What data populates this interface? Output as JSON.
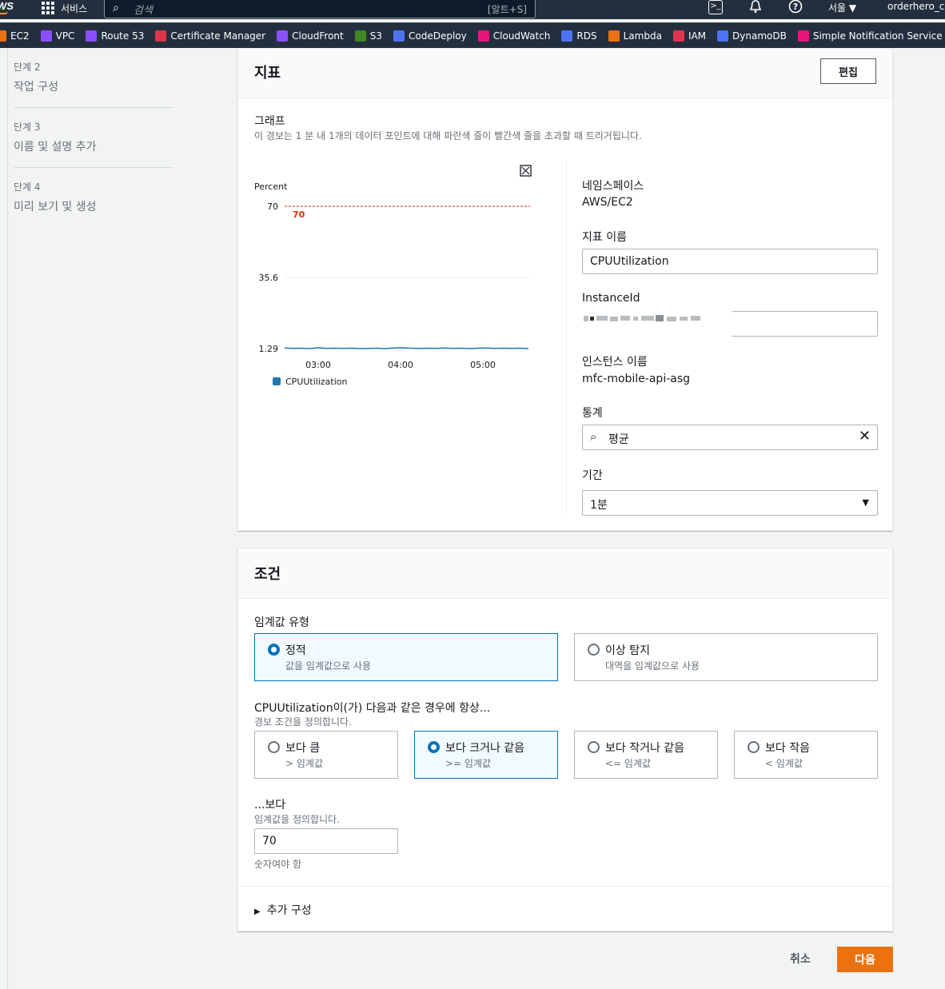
{
  "topnav": {
    "logo": "WS",
    "services_label": "서비스",
    "search_placeholder": "검색",
    "search_shortcut": "[알트+S]",
    "region": "서울 ▼",
    "account": "orderhero_ch"
  },
  "favorites": [
    {
      "label": "EC2",
      "color": "#ec7211"
    },
    {
      "label": "VPC",
      "color": "#8c4fff"
    },
    {
      "label": "Route 53",
      "color": "#8c4fff"
    },
    {
      "label": "Certificate Manager",
      "color": "#dd344c"
    },
    {
      "label": "CloudFront",
      "color": "#8c4fff"
    },
    {
      "label": "S3",
      "color": "#3f8624"
    },
    {
      "label": "CodeDeploy",
      "color": "#4d72f3"
    },
    {
      "label": "CloudWatch",
      "color": "#e7157b"
    },
    {
      "label": "RDS",
      "color": "#4d72f3"
    },
    {
      "label": "Lambda",
      "color": "#ec7211"
    },
    {
      "label": "IAM",
      "color": "#dd344c"
    },
    {
      "label": "DynamoDB",
      "color": "#4d72f3"
    },
    {
      "label": "Simple Notification Service",
      "color": "#e7157b"
    }
  ],
  "steps": [
    {
      "num": "단계 2",
      "name": "작업 구성"
    },
    {
      "num": "단계 3",
      "name": "이름 및 설명 추가"
    },
    {
      "num": "단계 4",
      "name": "미리 보기 및 생성"
    }
  ],
  "metric": {
    "title": "지표",
    "edit": "편집",
    "graph_label": "그래프",
    "graph_desc": "이 경보는 1 분 내 1개의 데이터 포인트에 대해 파란색 줄이 빨간색 줄을 초과할 때 트리거됩니다.",
    "namespace_label": "네임스페이스",
    "namespace_value": "AWS/EC2",
    "metric_name_label": "지표 이름",
    "metric_name_value": "CPUUtilization",
    "instanceid_label": "InstanceId",
    "instance_name_label": "인스턴스 이름",
    "instance_name_value": "mfc-mobile-api-asg",
    "statistic_label": "통계",
    "statistic_value": "평균",
    "period_label": "기간",
    "period_value": "1분"
  },
  "chart_data": {
    "type": "line",
    "ylabel": "Percent",
    "yticks": [
      "70",
      "35.6",
      "1.29"
    ],
    "ylim": [
      1.29,
      70
    ],
    "xticks": [
      "03:00",
      "04:00",
      "05:00"
    ],
    "threshold": {
      "value": 70,
      "label": "70",
      "color": "#d13212"
    },
    "series": [
      {
        "name": "CPUUtilization",
        "color": "#1f77b4",
        "values": [
          1.6,
          1.4,
          1.5,
          1.3,
          1.7,
          1.4,
          1.5,
          1.4,
          1.5,
          1.3,
          1.4,
          1.5,
          1.3,
          1.6,
          1.7,
          1.5,
          1.4,
          1.5,
          1.4,
          1.6,
          1.4,
          1.5,
          1.3,
          1.5,
          1.6,
          1.4,
          1.5,
          1.4,
          1.5,
          1.3
        ]
      }
    ]
  },
  "conditions": {
    "title": "조건",
    "threshold_type_label": "임계값 유형",
    "static_title": "정적",
    "static_desc": "값을 임계값으로 사용",
    "anomaly_title": "이상 탐지",
    "anomaly_desc": "대역을 임계값으로 사용",
    "whenever_label": "CPUUtilization이(가) 다음과 같은 경우에 항상...",
    "whenever_desc": "경보 조건을 정의합니다.",
    "ops": [
      {
        "title": "보다 큼",
        "desc": "> 임계값"
      },
      {
        "title": "보다 크거나 같음",
        "desc": ">= 임계값"
      },
      {
        "title": "보다 작거나 같음",
        "desc": "<= 임계값"
      },
      {
        "title": "보다 작음",
        "desc": "< 임계값"
      }
    ],
    "than_label": "...보다",
    "than_desc": "임계값을 정의합니다.",
    "than_value": "70",
    "than_hint": "숫자여야 함",
    "additional": "추가 구성"
  },
  "footer": {
    "cancel": "취소",
    "next": "다음"
  }
}
